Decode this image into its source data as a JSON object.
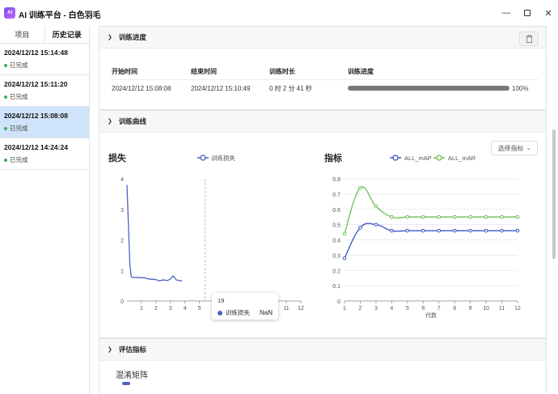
{
  "window": {
    "title": "AI 训练平台 - 白色羽毛",
    "icon_text": "AI"
  },
  "sidebar": {
    "tabs": [
      {
        "label": "项目"
      },
      {
        "label": "历史记录"
      }
    ],
    "items": [
      {
        "time": "2024/12/12 15:14:48",
        "status": "已完成"
      },
      {
        "time": "2024/12/12 15:11:20",
        "status": "已完成"
      },
      {
        "time": "2024/12/12 15:08:08",
        "status": "已完成"
      },
      {
        "time": "2024/12/12 14:24:24",
        "status": "已完成"
      }
    ]
  },
  "progress_panel": {
    "title": "训练进度",
    "headers": {
      "start": "开始时间",
      "end": "结束时间",
      "duration": "训练时长",
      "progress": "训练进度"
    },
    "row": {
      "start": "2024/12/12 15:08:08",
      "end": "2024/12/12 15:10:49",
      "duration": "0 时 2 分 41 秒",
      "progress_text": "100%",
      "progress_value": 1.0
    }
  },
  "curve_panel": {
    "title": "训练曲线",
    "select_label": "选择指标",
    "tooltip": {
      "epoch": "19",
      "series": "训练损失",
      "value": "NaN"
    }
  },
  "eval_panel": {
    "title": "评估指标",
    "section_label": "混淆矩阵"
  },
  "chart_data": [
    {
      "type": "line",
      "title": "损失",
      "series": [
        {
          "name": "训练损失",
          "color": "#4b63c7",
          "points": [
            [
              0.0,
              3.8
            ],
            [
              0.1,
              2.5
            ],
            [
              0.2,
              1.2
            ],
            [
              0.3,
              0.78
            ],
            [
              0.6,
              0.77
            ],
            [
              1.0,
              0.76
            ],
            [
              1.2,
              0.76
            ],
            [
              1.5,
              0.72
            ],
            [
              2.0,
              0.7
            ],
            [
              2.2,
              0.66
            ],
            [
              2.5,
              0.69
            ],
            [
              2.8,
              0.67
            ],
            [
              3.0,
              0.72
            ],
            [
              3.2,
              0.82
            ],
            [
              3.4,
              0.69
            ],
            [
              3.6,
              0.67
            ],
            [
              3.8,
              0.66
            ]
          ]
        }
      ],
      "x_ticks": [
        "1",
        "2",
        "3",
        "4",
        "5",
        "6",
        "7",
        "8",
        "9",
        "10",
        "11",
        "12"
      ],
      "y_ticks": [
        "0",
        "1",
        "2",
        "3",
        "4"
      ],
      "xlim": [
        0,
        12
      ],
      "ylim": [
        0,
        4
      ],
      "crosshair_x": 5.4
    },
    {
      "type": "line",
      "title": "指标",
      "xlabel": "代数",
      "categories": [
        1,
        2,
        3,
        4,
        5,
        6,
        7,
        8,
        9,
        10,
        11,
        12
      ],
      "series": [
        {
          "name": "ALL_mAP",
          "color": "#3a55c4",
          "values": [
            0.28,
            0.48,
            0.5,
            0.46,
            0.46,
            0.46,
            0.46,
            0.46,
            0.46,
            0.46,
            0.46,
            0.46
          ]
        },
        {
          "name": "ALL_mAR",
          "color": "#6cbf4f",
          "values": [
            0.44,
            0.74,
            0.62,
            0.55,
            0.55,
            0.55,
            0.55,
            0.55,
            0.55,
            0.55,
            0.55,
            0.55
          ]
        }
      ],
      "y_ticks": [
        "0",
        "0.1",
        "0.2",
        "0.3",
        "0.4",
        "0.5",
        "0.6",
        "0.7",
        "0.8"
      ],
      "xlim": [
        1,
        12
      ],
      "ylim": [
        0,
        0.8
      ]
    }
  ]
}
